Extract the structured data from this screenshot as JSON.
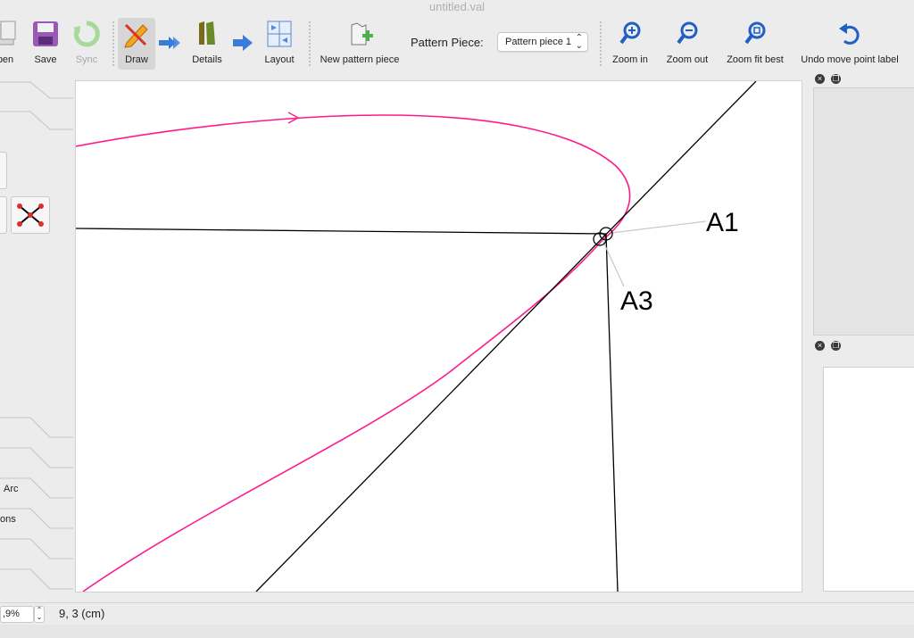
{
  "window": {
    "title": "untitled.val"
  },
  "toolbar": {
    "open_label": "pen",
    "save_label": "Save",
    "sync_label": "Sync",
    "draw_label": "Draw",
    "details_label": "Details",
    "layout_label": "Layout",
    "new_piece_label": "New pattern piece",
    "pattern_piece_label": "Pattern Piece:",
    "pattern_piece_value": "Pattern piece 1",
    "zoom_in_label": "Zoom in",
    "zoom_out_label": "Zoom out",
    "zoom_fit_label": "Zoom fit best",
    "undo_label": "Undo move point label"
  },
  "left_panel": {
    "items": [
      "Arc",
      "ons"
    ]
  },
  "canvas": {
    "points": [
      {
        "label": "A1"
      },
      {
        "label": "A3"
      }
    ],
    "colors": {
      "curve": "#ff1a8c",
      "line": "#000000",
      "leader": "#c8c8c8"
    }
  },
  "status": {
    "zoom": ",9%",
    "coords": "9, 3 (cm)"
  },
  "icons": [
    "open-icon",
    "save-icon",
    "sync-icon",
    "draw-icon",
    "arrow-icon",
    "details-icon",
    "layout-icon",
    "new-piece-icon",
    "zoom-in-icon",
    "zoom-out-icon",
    "zoom-fit-icon",
    "undo-icon",
    "close-icon",
    "float-icon"
  ]
}
